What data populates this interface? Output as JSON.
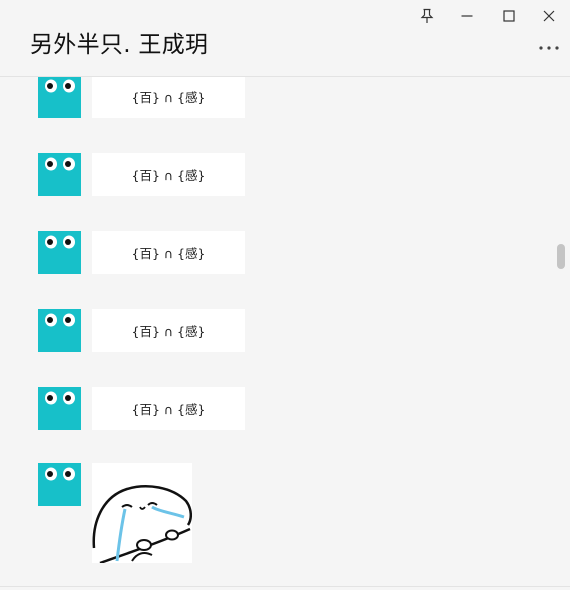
{
  "window": {
    "title": "另外半只. 王成玥"
  },
  "controls": {
    "pin": "pin-icon",
    "minimize": "minimize-icon",
    "maximize": "maximize-icon",
    "close": "close-icon",
    "more": "more-options-icon"
  },
  "messages": [
    {
      "sender_avatar": "googly-eyes-avatar",
      "text": "{百} ∩ {感}"
    },
    {
      "sender_avatar": "googly-eyes-avatar",
      "text": "{百} ∩ {感}"
    },
    {
      "sender_avatar": "googly-eyes-avatar",
      "text": "{百} ∩ {感}"
    },
    {
      "sender_avatar": "googly-eyes-avatar",
      "text": "{百} ∩ {感}"
    },
    {
      "sender_avatar": "googly-eyes-avatar",
      "text": "{百} ∩ {感}"
    },
    {
      "sender_avatar": "googly-eyes-avatar",
      "sticker": "crying-blob-sticker"
    }
  ],
  "colors": {
    "avatar_bg": "#17c0c9",
    "bubble_bg": "#ffffff",
    "window_bg": "#f5f5f5"
  }
}
